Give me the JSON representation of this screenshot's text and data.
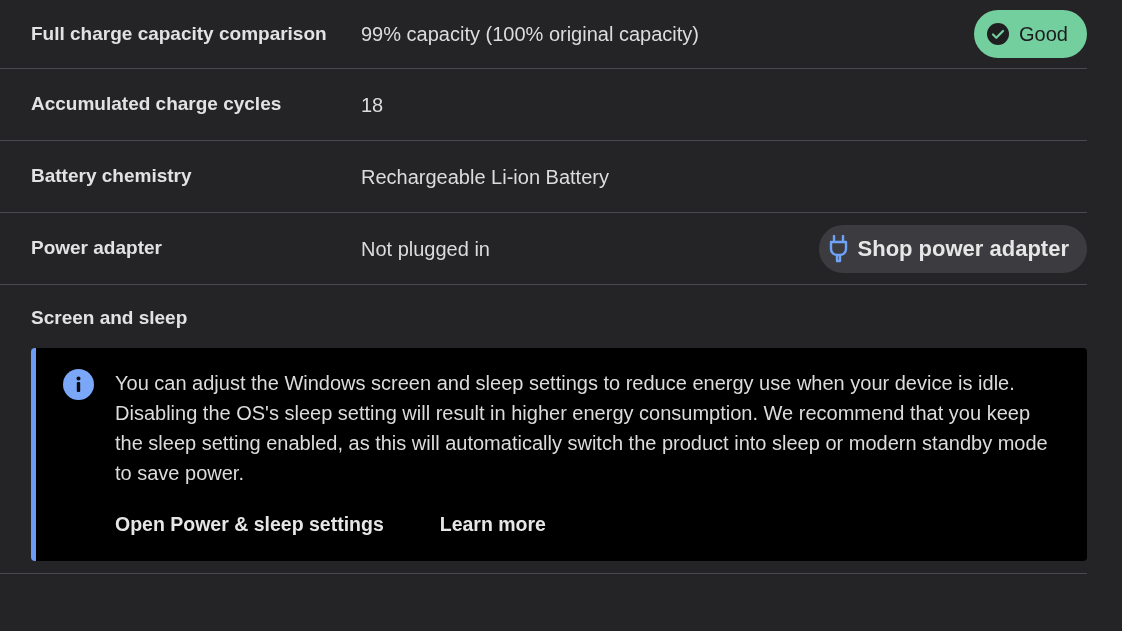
{
  "rows": [
    {
      "label": "Full charge capacity comparison",
      "value": "99% capacity (100% original capacity)",
      "action": {
        "kind": "badge",
        "text": "Good"
      }
    },
    {
      "label": "Accumulated charge cycles",
      "value": "18"
    },
    {
      "label": "Battery chemistry",
      "value": "Rechargeable Li-ion Battery"
    },
    {
      "label": "Power adapter",
      "value": "Not plugged in",
      "action": {
        "kind": "button",
        "text": "Shop power adapter"
      }
    }
  ],
  "section": {
    "title": "Screen and sleep",
    "notice": {
      "text": "You can adjust the Windows screen and sleep settings to reduce energy use when your device is idle. Disabling the OS's sleep setting will result in higher energy consumption. We recommend that you keep the sleep setting enabled, as this will automatically switch the product into sleep or modern standby mode to save power.",
      "links": [
        "Open Power & sleep settings",
        "Learn more"
      ]
    }
  }
}
